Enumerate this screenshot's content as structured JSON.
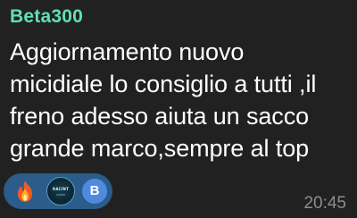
{
  "message": {
    "sender_name": "Beta300",
    "sender_color": "#5fe0b6",
    "text": "Aggiornamento nuovo\nmicidiale lo consiglio a tutti ,il\nfreno adesso aiuta un sacco\ngrande marco,sempre al top",
    "time": "20:45"
  },
  "reactions": {
    "background_color": "#2b5c8a",
    "emoji_icon": "fire-emoji-icon",
    "reactors": [
      {
        "type": "logo-avatar",
        "logo_text": "RACINT",
        "logo_sub": "CORSE"
      },
      {
        "type": "initial-avatar",
        "initial": "B",
        "color": "#4e8be0"
      }
    ]
  }
}
